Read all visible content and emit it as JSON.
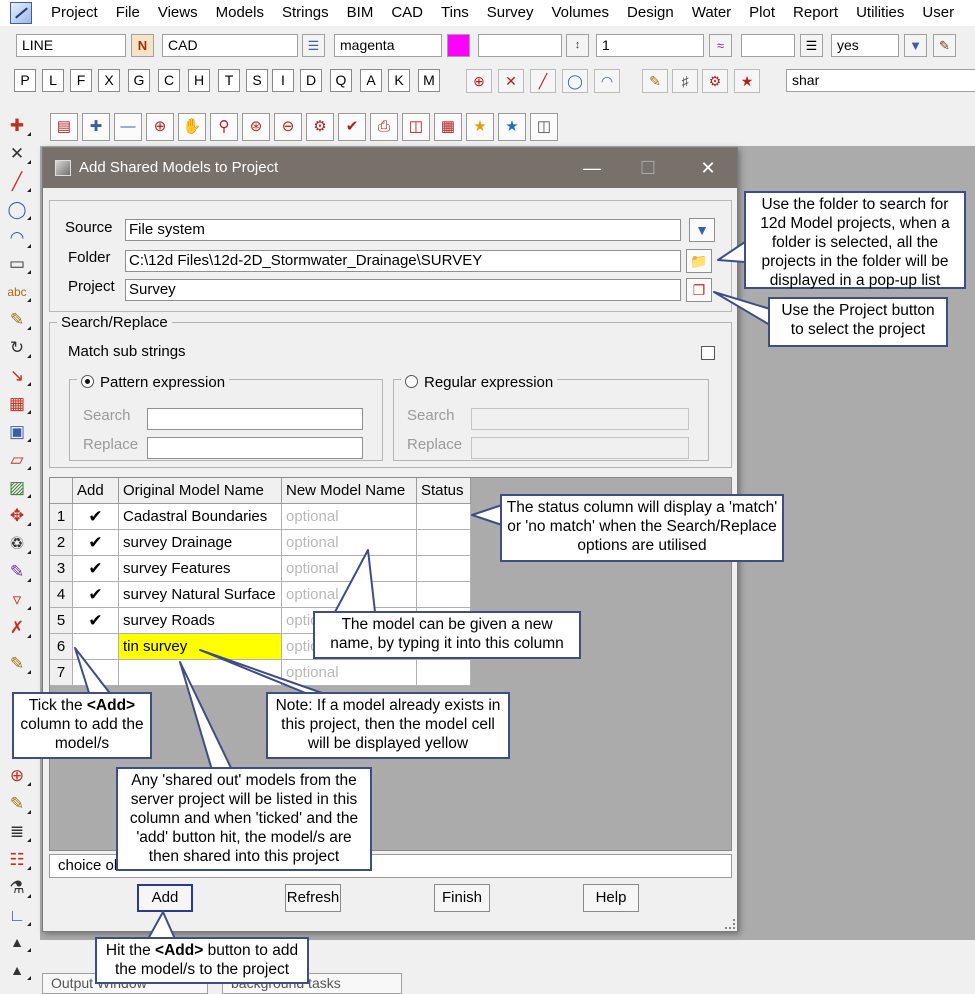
{
  "menubar": {
    "items": [
      "Project",
      "File",
      "Views",
      "Models",
      "Strings",
      "BIM",
      "CAD",
      "Tins",
      "Survey",
      "Volumes",
      "Design",
      "Water",
      "Plot",
      "Report",
      "Utilities",
      "User"
    ]
  },
  "attribute_bar": {
    "name": "LINE",
    "name_button": "N",
    "model": "CAD",
    "colour": "magenta",
    "colour_hex": "#ff00ff",
    "weight": "1",
    "flag": "yes"
  },
  "letter_toolbar": {
    "letters": [
      "P",
      "L",
      "F",
      "X",
      "G",
      "C",
      "H",
      "T",
      "S",
      "I",
      "D",
      "Q",
      "A",
      "K",
      "M"
    ],
    "search_value": "shar"
  },
  "dialog": {
    "title": "Add Shared Models to Project",
    "source_label": "Source",
    "source_value": "File system",
    "folder_label": "Folder",
    "folder_value": "C:\\12d Files\\12d-2D_Stormwater_Drainage\\SURVEY",
    "project_label": "Project",
    "project_value": "Survey",
    "search_replace_title": "Search/Replace",
    "match_sub_strings": "Match sub strings",
    "pattern_expression": "Pattern expression",
    "regular_expression": "Regular expression",
    "search_label": "Search",
    "replace_label": "Replace",
    "grid": {
      "headers": [
        "Add",
        "Original Model Name",
        "New Model Name",
        "Status"
      ],
      "rows": [
        {
          "n": "1",
          "checked": true,
          "original": "Cadastral Boundaries",
          "new": "optional",
          "status": ""
        },
        {
          "n": "2",
          "checked": true,
          "original": "survey Drainage",
          "new": "optional",
          "status": ""
        },
        {
          "n": "3",
          "checked": true,
          "original": "survey Features",
          "new": "optional",
          "status": ""
        },
        {
          "n": "4",
          "checked": true,
          "original": "survey Natural Surface",
          "new": "optional",
          "status": ""
        },
        {
          "n": "5",
          "checked": true,
          "original": "survey Roads",
          "new": "optional",
          "status": ""
        },
        {
          "n": "6",
          "checked": false,
          "original": "tin survey",
          "new": "optional",
          "status": "",
          "highlight": "#ffff00"
        },
        {
          "n": "7",
          "checked": false,
          "original": "",
          "new": "optional",
          "status": ""
        }
      ]
    },
    "status_text": "choice ok",
    "buttons": {
      "add": "Add",
      "refresh": "Refresh",
      "finish": "Finish",
      "help": "Help"
    }
  },
  "callouts": {
    "folder": "Use the folder to search for 12d Model projects, when a folder is selected, all the projects in the folder will be displayed in a pop-up list",
    "project": "Use the Project button to select the project",
    "status": "The status column will display a 'match' or 'no match' when the Search/Replace options are utilised",
    "new_name": "The model can be given a new name, by typing it into this column",
    "yellow": "Note: If a model already exists in this project, then the model cell will be displayed yellow",
    "shared": "Any 'shared out' models from the server project will be listed in this column and when 'ticked' and the 'add' button hit, the model/s are then shared into this project",
    "tick_pre": "Tick the ",
    "tick_bold": "<Add>",
    "tick_post": " column to add the model/s",
    "hit_pre": "Hit the ",
    "hit_bold": "<Add>",
    "hit_post": " button to add the model/s to the project"
  },
  "bottom_tabs": [
    "Output Window",
    "background tasks"
  ]
}
